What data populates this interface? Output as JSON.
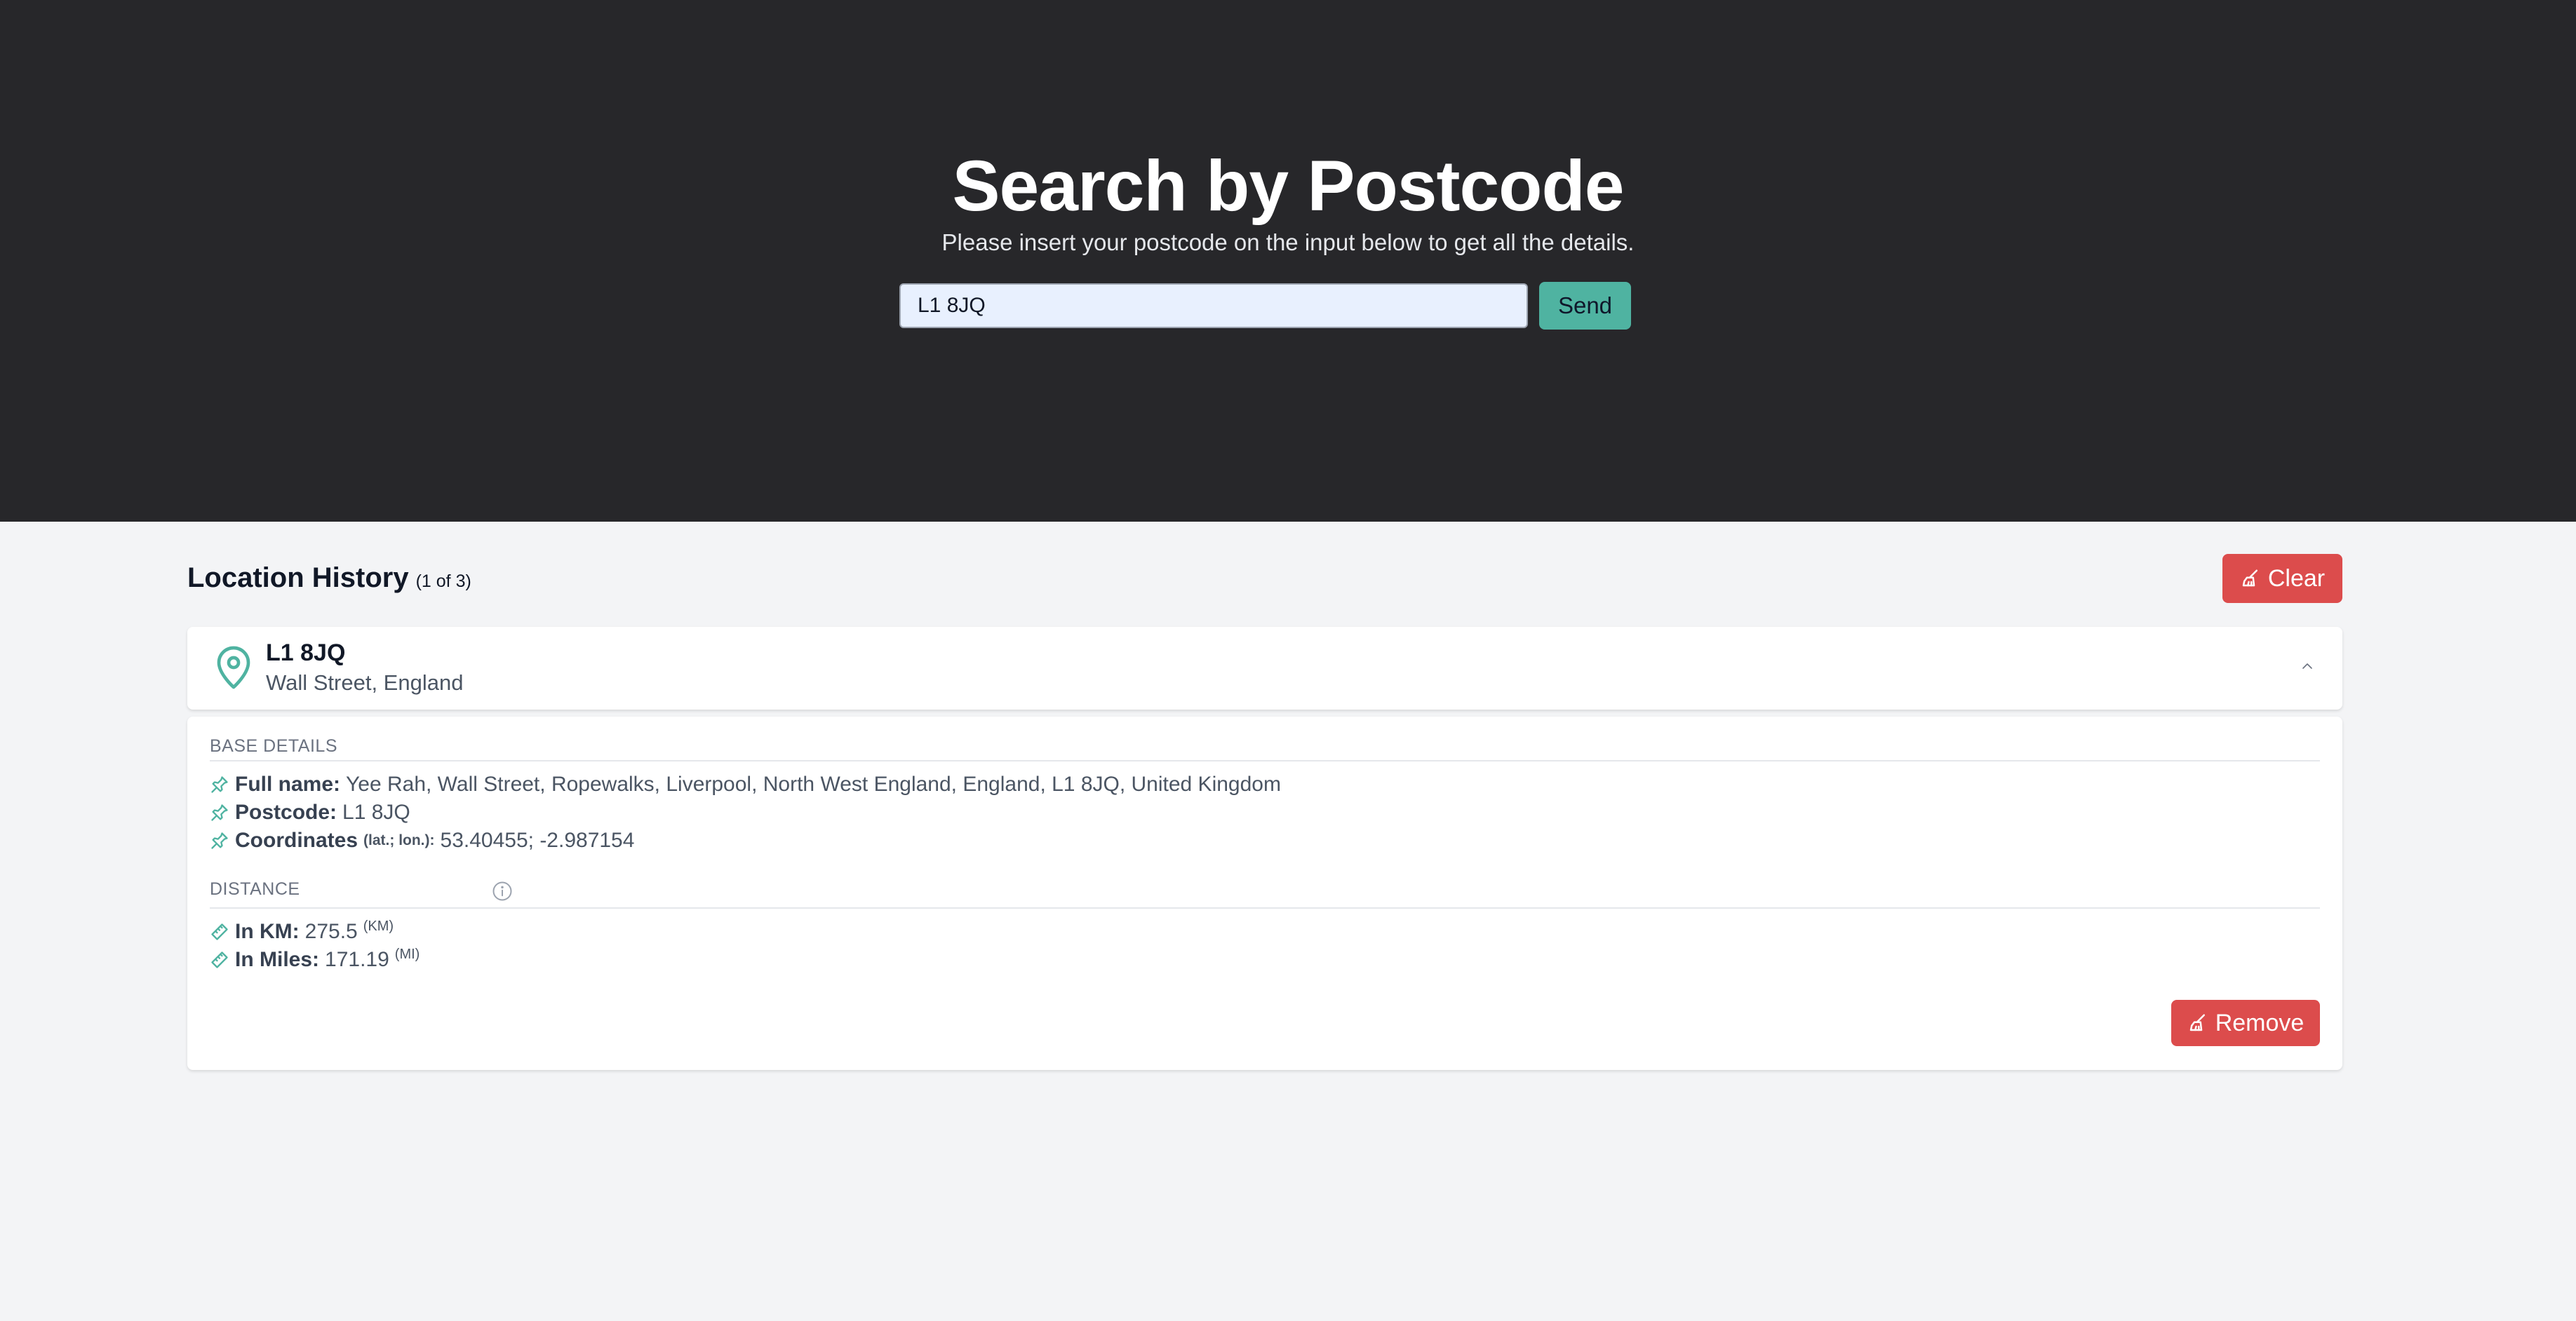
{
  "hero": {
    "title": "Search by Postcode",
    "subtitle": "Please insert your postcode on the input below to get all the details.",
    "search_value": "L1 8JQ",
    "send_label": "Send"
  },
  "history": {
    "title": "Location History",
    "count": "(1 of 3)",
    "clear_label": "Clear",
    "item": {
      "postcode": "L1 8JQ",
      "area": "Wall Street, England",
      "base_details": {
        "heading": "BASE DETAILS",
        "full_name_label": "Full name:",
        "full_name_value": "Yee Rah, Wall Street, Ropewalks, Liverpool, North West England, England, L1 8JQ, United Kingdom",
        "postcode_label": "Postcode:",
        "postcode_value": "L1 8JQ",
        "coordinates_label": "Coordinates",
        "coordinates_hint": "(lat.; lon.):",
        "coordinates_value": "53.40455; -2.987154"
      },
      "distance": {
        "heading": "DISTANCE",
        "km_label": "In KM:",
        "km_value": "275.5",
        "km_unit": "(KM)",
        "miles_label": "In Miles:",
        "miles_value": "171.19",
        "miles_unit": "(MI)"
      },
      "remove_label": "Remove"
    }
  },
  "icons": {
    "pin": "map-pin-icon",
    "chevron": "chevron-up-icon",
    "pushpin": "pushpin-icon",
    "ruler": "ruler-icon",
    "info": "info-icon",
    "broom": "broom-icon"
  },
  "colors": {
    "hero_bg": "#27272a",
    "accent": "#4fb3a1",
    "danger": "#dc4c4c"
  }
}
